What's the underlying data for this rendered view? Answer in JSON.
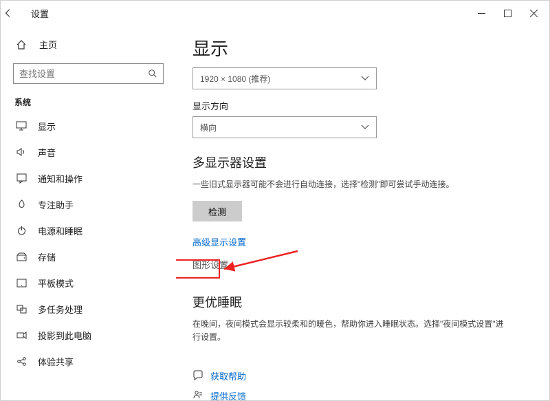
{
  "titlebar": {
    "title": "设置"
  },
  "sidebar": {
    "home": "主页",
    "search_placeholder": "查找设置",
    "section": "系统",
    "items": [
      {
        "label": "显示"
      },
      {
        "label": "声音"
      },
      {
        "label": "通知和操作"
      },
      {
        "label": "专注助手"
      },
      {
        "label": "电源和睡眠"
      },
      {
        "label": "存储"
      },
      {
        "label": "平板模式"
      },
      {
        "label": "多任务处理"
      },
      {
        "label": "投影到此电脑"
      },
      {
        "label": "体验共享"
      }
    ]
  },
  "content": {
    "heading": "显示",
    "resolution_value": "1920 × 1080 (推荐)",
    "orientation_label": "显示方向",
    "orientation_value": "横向",
    "multi_heading": "多显示器设置",
    "multi_desc": "一些旧式显示器可能不会进行自动连接，选择\"检测\"即可尝试手动连接。",
    "detect_btn": "检测",
    "adv_link": "高级显示设置",
    "graphics_link": "图形设置",
    "sleep_heading": "更优睡眠",
    "sleep_desc": "在晚间，夜间模式会显示较柔和的暖色，帮助你进入睡眠状态。选择\"夜间模式设置\"进行设置。",
    "help": "获取帮助",
    "feedback": "提供反馈"
  }
}
